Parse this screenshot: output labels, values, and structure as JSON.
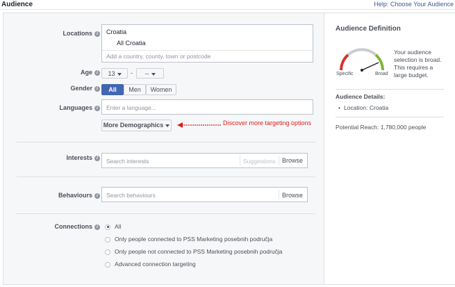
{
  "header": {
    "title": "Audience",
    "help_link": "Help: Choose Your Audience"
  },
  "locations": {
    "label": "Locations",
    "country": "Croatia",
    "selected": "All Croatia",
    "placeholder": "Add a country, county, town or postcode"
  },
  "age": {
    "label": "Age",
    "min": "13",
    "separator": "-",
    "max": "--"
  },
  "gender": {
    "label": "Gender",
    "options": [
      "All",
      "Men",
      "Women"
    ],
    "selected": "All"
  },
  "languages": {
    "label": "Languages",
    "placeholder": "Enter a language..."
  },
  "more_demographics": {
    "label": "More Demographics",
    "annotation": "Discover more targeting options",
    "annotation_color": "#e0201b"
  },
  "interests": {
    "label": "Interests",
    "placeholder": "Search interests",
    "suggestions": "Suggestions",
    "browse": "Browse"
  },
  "behaviours": {
    "label": "Behaviours",
    "placeholder": "Search behaviours",
    "browse": "Browse"
  },
  "connections": {
    "label": "Connections",
    "options": [
      "All",
      "Only people connected to PSS Marketing posebnih područja",
      "Only people not connected to PSS Marketing posebnih područja",
      "Advanced connection targeting"
    ],
    "selected": "All"
  },
  "definition": {
    "title": "Audience Definition",
    "gauge_left": "Specific",
    "gauge_right": "Broad",
    "description": "Your audience selection is broad. This requires a large budget.",
    "details_title": "Audience Details:",
    "details_item": "Location: Croatia",
    "reach": "Potential Reach: 1,780,000 people"
  },
  "colors": {
    "accent": "#4267b2",
    "link": "#3b5998",
    "gauge_red": "#d9302a",
    "gauge_green": "#7fb539"
  }
}
